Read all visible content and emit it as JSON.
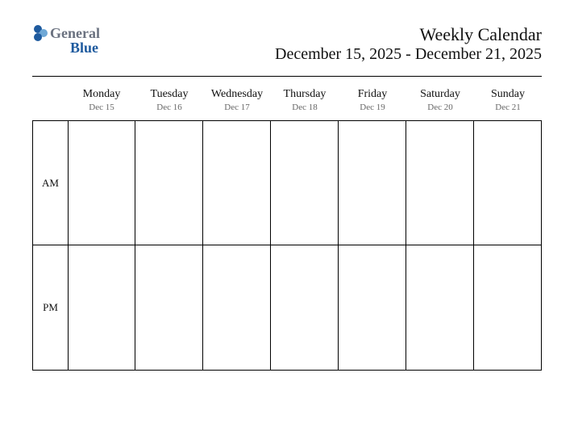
{
  "logo": {
    "text_top": "General",
    "text_bottom": "Blue"
  },
  "header": {
    "title": "Weekly Calendar",
    "date_range": "December 15, 2025 - December 21, 2025"
  },
  "days": [
    {
      "name": "Monday",
      "date": "Dec 15"
    },
    {
      "name": "Tuesday",
      "date": "Dec 16"
    },
    {
      "name": "Wednesday",
      "date": "Dec 17"
    },
    {
      "name": "Thursday",
      "date": "Dec 18"
    },
    {
      "name": "Friday",
      "date": "Dec 19"
    },
    {
      "name": "Saturday",
      "date": "Dec 20"
    },
    {
      "name": "Sunday",
      "date": "Dec 21"
    }
  ],
  "periods": {
    "am": "AM",
    "pm": "PM"
  }
}
